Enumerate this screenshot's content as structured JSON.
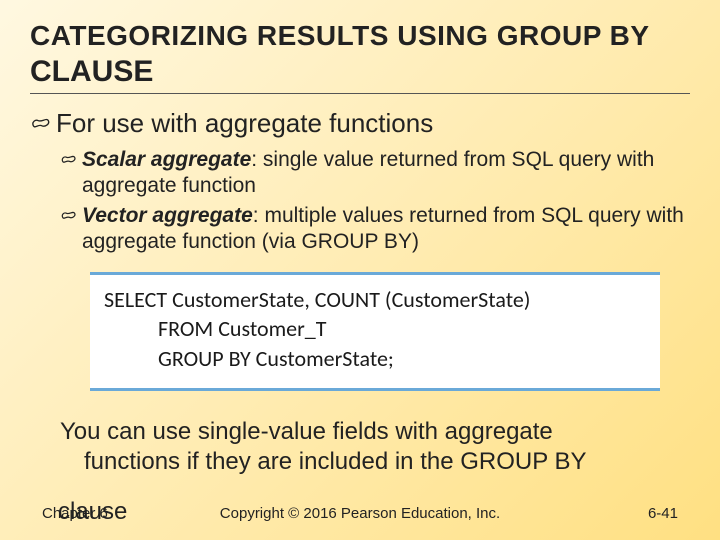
{
  "title": {
    "main": "CATEGORIZING RESULTS USING GROUP BY",
    "tail": "CLAUSE"
  },
  "bullet_main": "For use with aggregate functions",
  "sub_items": [
    {
      "term": "Scalar aggregate",
      "desc": ": single value returned from SQL query with aggregate function"
    },
    {
      "term": "Vector aggregate",
      "desc": ": multiple values returned from SQL query with aggregate function (via GROUP BY)"
    }
  ],
  "code": {
    "line1": "SELECT CustomerState, COUNT (CustomerState)",
    "line2": "FROM Customer_T",
    "line3": "GROUP BY CustomerState;"
  },
  "note": {
    "line1": "You can use single-value fields with aggregate",
    "line2": "functions if they are included in the GROUP BY",
    "line3_word": "clause"
  },
  "footer": {
    "chapter": "Chapter 6",
    "copyright": "Copyright © 2016 Pearson Education, Inc.",
    "pagenum": "6-41"
  }
}
